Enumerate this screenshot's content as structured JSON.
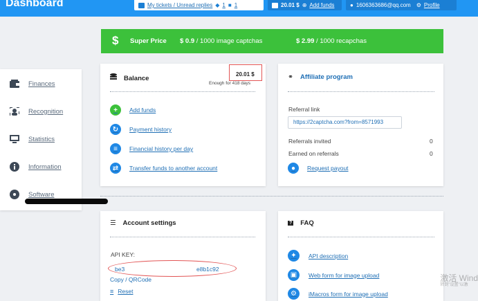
{
  "header": {
    "title": "Dashboard",
    "tickets": {
      "text": "My tickets / Unread replies",
      "count1": "1",
      "count2": "1"
    },
    "balance": "20.01 $",
    "add_funds": "Add funds",
    "user": "1606363686@qq.com",
    "profile": "Profile"
  },
  "sidebar": {
    "items": [
      {
        "label": "Finances",
        "icon": "wallet-icon"
      },
      {
        "label": "Recognition",
        "icon": "recognition-icon"
      },
      {
        "label": "Statistics",
        "icon": "monitor-icon"
      },
      {
        "label": "Information",
        "icon": "info-icon"
      },
      {
        "label": "Software",
        "icon": "disc-icon"
      }
    ]
  },
  "promo": {
    "label": "Super Price",
    "price1": "$ 0.9",
    "desc1": " / 1000 image captchas",
    "price2": "$ 2.99",
    "desc2": " / 1000 recapchas"
  },
  "balance_card": {
    "title": "Balance",
    "amount": "20.01 $",
    "sub": "Enough for 418 days",
    "links": [
      {
        "label": "Add funds",
        "icon": "plus-icon"
      },
      {
        "label": "Payment history",
        "icon": "history-icon"
      },
      {
        "label": "Financial history per day",
        "icon": "table-icon"
      },
      {
        "label": "Transfer funds to another account",
        "icon": "transfer-icon"
      }
    ]
  },
  "affiliate_card": {
    "title": "Affiliate program",
    "referral_label": "Referral link",
    "referral_link": "https://2captcha.com?from=8571993",
    "invited_label": "Referrals invited",
    "invited_value": "0",
    "earned_label": "Earned on referrals",
    "earned_value": "0",
    "request_payout": "Request payout"
  },
  "account_card": {
    "title": "Account settings",
    "api_key_label": "API KEY:",
    "api_key_start": "be3",
    "api_key_end": "e8b1c92",
    "copy": "Copy / QRCode",
    "reset": "Reset"
  },
  "faq_card": {
    "title": "FAQ",
    "links": [
      {
        "label": "API description",
        "icon": "puzzle-icon"
      },
      {
        "label": "Web form for image upload",
        "icon": "monitor-icon"
      },
      {
        "label": "iMacros form for image upload",
        "icon": "gears-icon"
      }
    ]
  },
  "watermark": {
    "line1": "激活 Wind",
    "line2": "转到\"设置\"以激"
  },
  "colors": {
    "header": "#2196f3",
    "promo": "#3cc13b",
    "link": "#1f6fb5",
    "highlight": "#e25454"
  }
}
